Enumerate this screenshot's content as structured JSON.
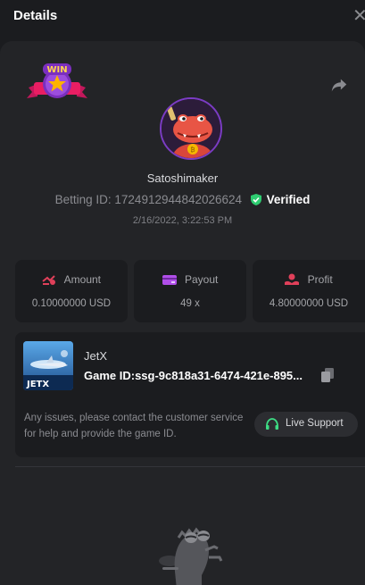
{
  "header": {
    "title": "Details",
    "close_glyph": "✕"
  },
  "icons": {
    "win_badge": "win-badge-icon",
    "share": "share-icon",
    "avatar": "crocodile-avatar",
    "verified": "verified-shield-icon",
    "amount": "amount-icon",
    "payout": "payout-wallet-icon",
    "profit": "profit-icon",
    "copy": "copy-icon",
    "headset": "headset-icon"
  },
  "badge": {
    "text": "WIN"
  },
  "player": {
    "username": "Satoshimaker",
    "betting_id_label": "Betting ID:",
    "betting_id": "1724912944842026624",
    "verified_label": "Verified",
    "timestamp": "2/16/2022, 3:22:53 PM"
  },
  "stats": [
    {
      "label": "Amount",
      "value": "0.10000000 USD",
      "icon_color": "#e0405a"
    },
    {
      "label": "Payout",
      "value": "49 x",
      "icon_color": "#b04ee8"
    },
    {
      "label": "Profit",
      "value": "4.80000000 USD",
      "icon_color": "#e0405a"
    }
  ],
  "game": {
    "name": "JetX",
    "thumb_label": "JETX",
    "game_id": "Game ID:ssg-9c818a31-6474-421e-895..."
  },
  "support": {
    "help_text": "Any issues, please contact the customer service for help and provide the game ID.",
    "button_label": "Live Support"
  },
  "colors": {
    "background": "#1b1c1f",
    "panel": "#232427",
    "verified_green": "#2ecc71",
    "support_green": "#3ddc84",
    "accent_red": "#e0405a",
    "accent_purple": "#b04ee8"
  }
}
